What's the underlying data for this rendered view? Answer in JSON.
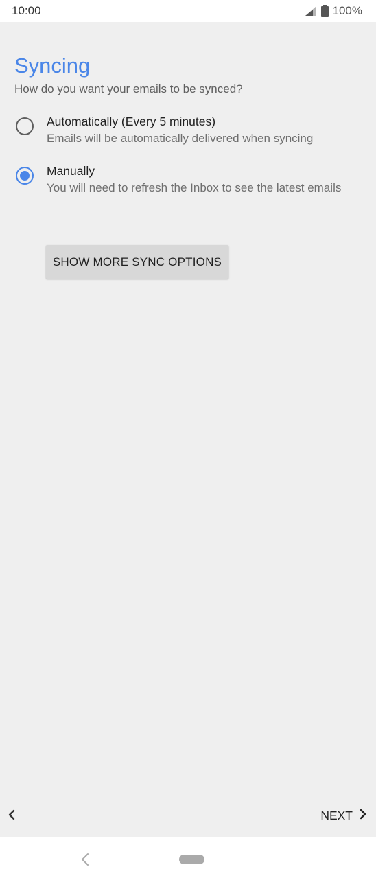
{
  "status_bar": {
    "time": "10:00",
    "battery": "100%"
  },
  "page": {
    "title": "Syncing",
    "subtitle": "How do you want your emails to be synced?"
  },
  "options": [
    {
      "label": "Automatically (Every 5 minutes)",
      "description": "Emails will be automatically delivered when syncing",
      "selected": false
    },
    {
      "label": "Manually",
      "description": "You will need to refresh the Inbox to see the latest emails",
      "selected": true
    }
  ],
  "buttons": {
    "more_sync_options": "SHOW MORE SYNC OPTIONS",
    "next": "NEXT"
  },
  "colors": {
    "accent": "#4a86e8",
    "background": "#efefef"
  },
  "icons": {
    "signal": "signal-icon",
    "battery": "battery-icon",
    "back": "chevron-left-icon",
    "next": "chevron-right-icon",
    "nav_back": "nav-back-icon",
    "nav_home": "nav-home-pill"
  }
}
